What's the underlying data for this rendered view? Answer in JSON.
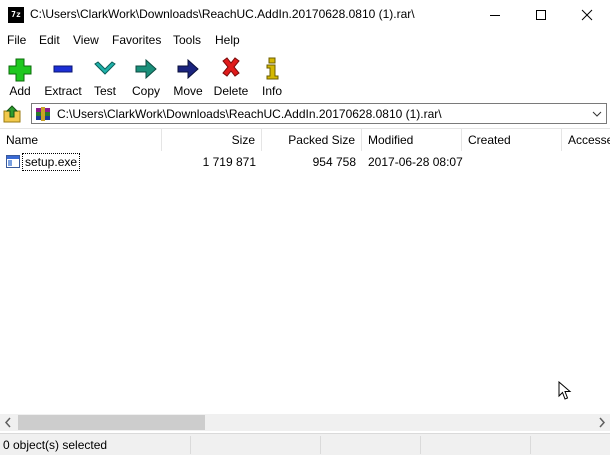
{
  "window": {
    "app_icon_text": "7z",
    "title": "C:\\Users\\ClarkWork\\Downloads\\ReachUC.AddIn.20170628.0810 (1).rar\\"
  },
  "menu": [
    "File",
    "Edit",
    "View",
    "Favorites",
    "Tools",
    "Help"
  ],
  "toolbar": [
    {
      "label": "Add",
      "icon": "plus-icon",
      "color": "#1fc81f"
    },
    {
      "label": "Extract",
      "icon": "minus-icon",
      "color": "#1c2fd6"
    },
    {
      "label": "Test",
      "icon": "check-icon",
      "color": "#20b2aa"
    },
    {
      "label": "Copy",
      "icon": "copy-arrow-icon",
      "color": "#1a8f7a"
    },
    {
      "label": "Move",
      "icon": "move-arrow-icon",
      "color": "#1a237e"
    },
    {
      "label": "Delete",
      "icon": "delete-x-icon",
      "color": "#e01b1b"
    },
    {
      "label": "Info",
      "icon": "info-icon",
      "color": "#d4b800"
    }
  ],
  "address": {
    "path": "C:\\Users\\ClarkWork\\Downloads\\ReachUC.AddIn.20170628.0810 (1).rar\\"
  },
  "columns": [
    "Name",
    "Size",
    "Packed Size",
    "Modified",
    "Created",
    "Accessed"
  ],
  "files": [
    {
      "name": "setup.exe",
      "size": "1 719 871",
      "packed_size": "954 758",
      "modified": "2017-06-28 08:07",
      "created": "",
      "accessed": ""
    }
  ],
  "status": {
    "selected": "0 object(s) selected"
  }
}
